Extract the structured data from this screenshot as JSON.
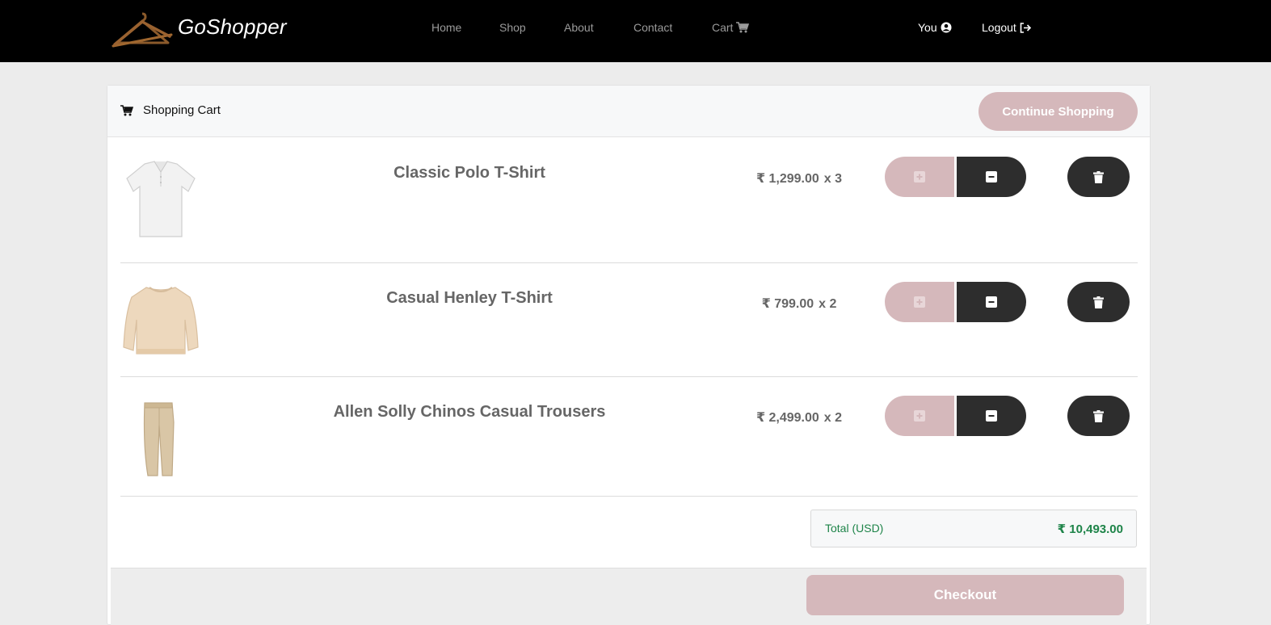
{
  "brand": {
    "name": "GoShopper",
    "logo_icon": "hanger-icon"
  },
  "nav": {
    "links": [
      {
        "label": "Home"
      },
      {
        "label": "Shop"
      },
      {
        "label": "About"
      },
      {
        "label": "Contact"
      },
      {
        "label": "Cart",
        "icon": "cart-icon"
      }
    ],
    "user_label": "You",
    "user_icon": "user-circle-icon",
    "logout_label": "Logout",
    "logout_icon": "logout-icon"
  },
  "cart": {
    "title": "Shopping Cart",
    "title_icon": "cart-icon",
    "continue_label": "Continue Shopping",
    "items": [
      {
        "name": "Classic Polo T-Shirt",
        "price": "₹ 1,299.00",
        "qty": "x 3",
        "image": "white-polo-shirt"
      },
      {
        "name": "Casual Henley T-Shirt",
        "price": "₹ 799.00",
        "qty": "x 2",
        "image": "beige-sweatshirt"
      },
      {
        "name": "Allen Solly Chinos Casual Trousers",
        "price": "₹ 2,499.00",
        "qty": "x 2",
        "image": "khaki-chinos"
      }
    ],
    "total_label": "Total (USD)",
    "total_value": "₹ 10,493.00",
    "checkout_label": "Checkout"
  },
  "colors": {
    "navbar_bg": "#000000",
    "accent_pink": "#d5b8bb",
    "dark_button": "#2d2d2d",
    "total_green": "#1e8449",
    "page_bg": "#ececec"
  }
}
